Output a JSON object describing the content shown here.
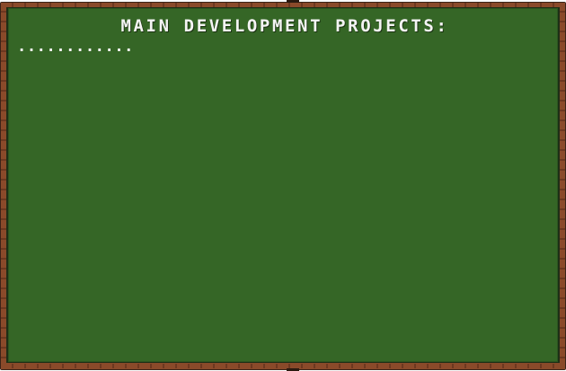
{
  "board": {
    "title": "MAIN DEVELOPMENT PROJECTS:",
    "line_1": "............",
    "colors": {
      "board_green": "#356626",
      "frame_wood": "#8a4a2a",
      "chalk_text": "#f4f4f4"
    }
  }
}
